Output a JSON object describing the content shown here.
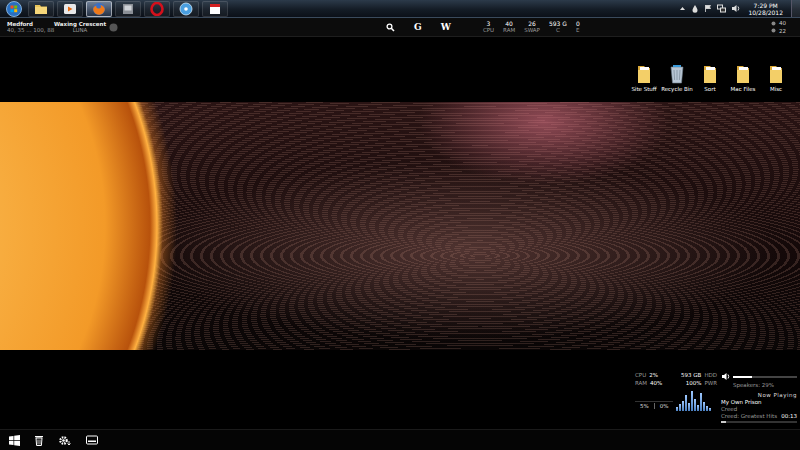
{
  "taskbar": {
    "buttons": [
      {
        "kind": "folder",
        "selected": false
      },
      {
        "kind": "media",
        "selected": false
      },
      {
        "kind": "firefox",
        "selected": true
      },
      {
        "kind": "app",
        "selected": false
      },
      {
        "kind": "opera",
        "selected": false
      },
      {
        "kind": "disc",
        "selected": false
      },
      {
        "kind": "calendar",
        "selected": false
      }
    ],
    "clock": {
      "time": "7:29 PM",
      "date": "10/28/2012"
    }
  },
  "weather": {
    "city": "Medford",
    "detail": "40, 35 ... 100, 88"
  },
  "moon": {
    "phase": "Waxing Crescent",
    "label": "LUNA"
  },
  "search": [
    "G",
    "W"
  ],
  "stats": [
    {
      "value": "3",
      "label": "CPU"
    },
    {
      "value": "40",
      "label": "RAM"
    },
    {
      "value": "26",
      "label": "SWAP"
    },
    {
      "value": "593 G",
      "label": "C"
    },
    {
      "value": "0",
      "label": "E"
    }
  ],
  "temps": [
    "40",
    "22"
  ],
  "desktop_icons": [
    {
      "label": "Site Stuff",
      "kind": "folder"
    },
    {
      "label": "Recycle Bin",
      "kind": "bin"
    },
    {
      "label": "Sort",
      "kind": "folder"
    },
    {
      "label": "Mac Files",
      "kind": "folder"
    },
    {
      "label": "Misc",
      "kind": "folder"
    }
  ],
  "system": [
    {
      "label": "CPU",
      "value": "2%",
      "side_value": "593 GB",
      "side_label": "HDD"
    },
    {
      "label": "RAM",
      "value": "40%",
      "side_value": "100%",
      "side_label": "PWR"
    }
  ],
  "visualizer": [
    0.2,
    0.35,
    0.5,
    0.8,
    0.4,
    1.0,
    0.6,
    0.3,
    0.9,
    0.45,
    0.25,
    0.15
  ],
  "usage": [
    "5%",
    "0%"
  ],
  "volume": {
    "label": "Speakers: 29%",
    "level": 0.29
  },
  "now_playing": {
    "title": "Now Playing",
    "track": "My Own Prison",
    "artist": "Creed",
    "album": "Creed: Greatest Hits",
    "time": "00:13",
    "level": 0.06
  }
}
